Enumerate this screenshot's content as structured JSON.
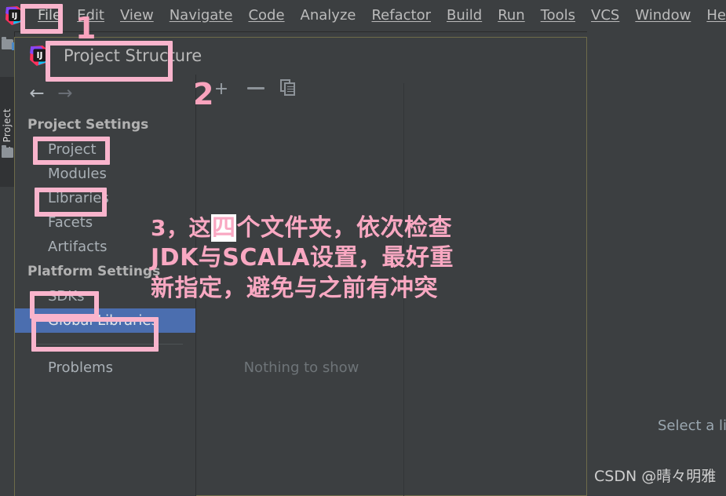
{
  "app": {
    "ide_logo": "intellij-idea-logo"
  },
  "menubar": {
    "items": [
      {
        "label": "File",
        "mnemonic": "F"
      },
      {
        "label": "Edit",
        "mnemonic": "E"
      },
      {
        "label": "View",
        "mnemonic": "V"
      },
      {
        "label": "Navigate",
        "mnemonic": "N"
      },
      {
        "label": "Code",
        "mnemonic": "C"
      },
      {
        "label": "Analyze",
        "mnemonic": "z"
      },
      {
        "label": "Refactor",
        "mnemonic": "R"
      },
      {
        "label": "Build",
        "mnemonic": "B"
      },
      {
        "label": "Run",
        "mnemonic": "u"
      },
      {
        "label": "Tools",
        "mnemonic": "T"
      },
      {
        "label": "VCS",
        "mnemonic": "S"
      },
      {
        "label": "Window",
        "mnemonic": "W"
      },
      {
        "label": "Help",
        "mnemonic": "H"
      }
    ]
  },
  "tool_window": {
    "project_tab_label": "1: Project"
  },
  "dialog": {
    "title": "Project Structure",
    "toolbar": {
      "back_icon": "arrow-left-icon",
      "forward_icon": "arrow-right-icon",
      "add_label": "+",
      "remove_icon": "minus-icon",
      "copy_icon": "copy-icon"
    },
    "sidebar": {
      "project_settings_header": "Project Settings",
      "project_settings_items": [
        {
          "label": "Project",
          "selected": false
        },
        {
          "label": "Modules",
          "selected": false
        },
        {
          "label": "Libraries",
          "selected": false
        },
        {
          "label": "Facets",
          "selected": false
        },
        {
          "label": "Artifacts",
          "selected": false
        }
      ],
      "platform_settings_header": "Platform Settings",
      "platform_settings_items": [
        {
          "label": "SDKs",
          "selected": false
        },
        {
          "label": "Global Libraries",
          "selected": true
        }
      ],
      "other_items": [
        {
          "label": "Problems",
          "selected": false
        }
      ]
    },
    "center_panel": {
      "empty_message": "Nothing to show"
    }
  },
  "right_pane": {
    "hint_text": "Select a lib"
  },
  "watermark": {
    "text": "CSDN @晴々明雅"
  },
  "annotations": {
    "accent_color": "#f9b4cc",
    "number_1": "1",
    "number_2": "2",
    "note_line1_pre": "3，这",
    "note_line1_highlight": "四",
    "note_line1_post": "个文件夹，依次检查",
    "note_line2": "JDK与SCALA设置，最好重",
    "note_line3": "新指定，避免与之前有冲突"
  }
}
